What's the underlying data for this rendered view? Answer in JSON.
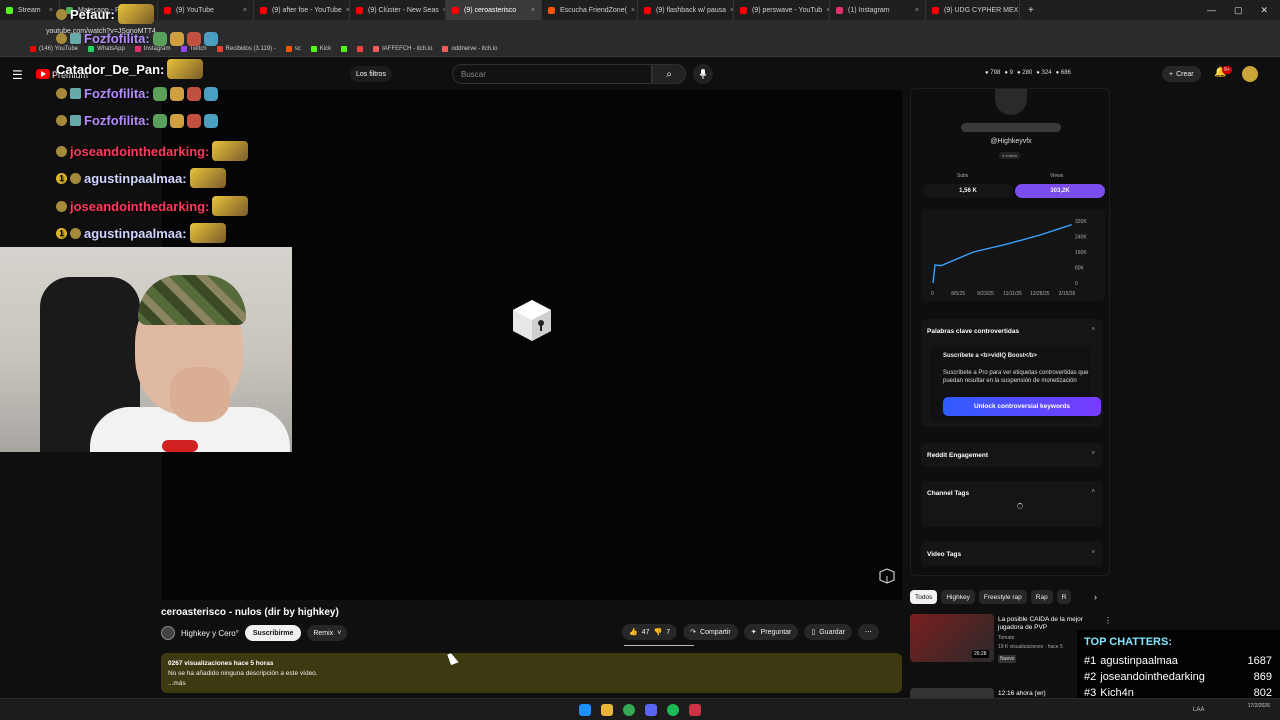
{
  "browser": {
    "tabs": [
      {
        "label": "Stream",
        "color": "#53fc18",
        "width": 60,
        "active": false
      },
      {
        "label": "",
        "color": "#53fc18",
        "width": 0,
        "active": false
      },
      {
        "label": "Matecapp - Ranking y",
        "color": "#4caf50",
        "width": 98,
        "active": false
      },
      {
        "label": "(9) YouTube",
        "color": "#ff0000",
        "width": 96,
        "active": false
      },
      {
        "label": "(9) after foe - YouTube",
        "color": "#ff0000",
        "width": 96,
        "active": false
      },
      {
        "label": "(9) Clúster - New Seas",
        "color": "#ff0000",
        "width": 96,
        "active": false
      },
      {
        "label": "(9) ceroasterisco",
        "color": "#ff0000",
        "width": 96,
        "active": true
      },
      {
        "label": "Escucha FriendZone(",
        "color": "#ff5500",
        "width": 96,
        "active": false
      },
      {
        "label": "(9) flashback w/ pausa",
        "color": "#ff0000",
        "width": 96,
        "active": false
      },
      {
        "label": "(9) perswave - YouTub",
        "color": "#ff0000",
        "width": 96,
        "active": false
      },
      {
        "label": "(1) Instagram",
        "color": "#e1306c",
        "width": 96,
        "active": false
      },
      {
        "label": "(9) UDG CYPHER MEX",
        "color": "#ff0000",
        "width": 94,
        "active": false
      }
    ],
    "tab_close": "×",
    "new_tab": "+",
    "window_controls": [
      "—",
      "▢",
      "✕"
    ],
    "url": "youtube.com/watch?v=JSgnoMTT4",
    "bookmarks": [
      {
        "label": "(146) YouTube",
        "color": "#ff0000"
      },
      {
        "label": "WhatsApp",
        "color": "#25d366"
      },
      {
        "label": "Instagram",
        "color": "#e1306c"
      },
      {
        "label": "Twitch",
        "color": "#9146ff"
      },
      {
        "label": "Recibidos (3.119) -",
        "color": "#ea4335"
      },
      {
        "label": "sc",
        "color": "#ff5500"
      },
      {
        "label": "Kick",
        "color": "#53fc18"
      },
      {
        "label": "",
        "color": "#53fc18"
      },
      {
        "label": "",
        "color": "#ff4444"
      },
      {
        "label": "IAFFEFCH - itch.io",
        "color": "#fa5c5c"
      },
      {
        "label": "oddnerve - itch.io",
        "color": "#fa5c5c"
      }
    ]
  },
  "youtube_header": {
    "menu_icon": "☰",
    "logo_text": "Premium",
    "filters_label": "Los filtros",
    "search_placeholder": "Buscar",
    "search_icon": "⌕",
    "mic_icon": "🎙",
    "stats": [
      "798",
      "9",
      "280",
      "324",
      "686"
    ],
    "create_label": "Crear",
    "notifications": "9+"
  },
  "chat": [
    {
      "user": "Pefaur:",
      "color": "#ffffff",
      "top": 2,
      "badges": [
        "gray"
      ],
      "emotes": 1
    },
    {
      "user": "Fozfofilita:",
      "color": "#b58cff",
      "top": 29,
      "badges": [
        "gray",
        "sub"
      ],
      "emotes": 4
    },
    {
      "user": "Catador_De_Pan:",
      "color": "#ffffff",
      "top": 57,
      "badges": [],
      "emotes": 1
    },
    {
      "user": "Fozfofilita:",
      "color": "#b58cff",
      "top": 84,
      "badges": [
        "gray",
        "sub"
      ],
      "emotes": 4
    },
    {
      "user": "Fozfofilita:",
      "color": "#b58cff",
      "top": 111,
      "badges": [
        "gray",
        "sub"
      ],
      "emotes": 4
    },
    {
      "user": "joseandointhedarking:",
      "color": "#ff3b5c",
      "top": 139,
      "badges": [
        "gray"
      ],
      "emotes": 1
    },
    {
      "user": "agustinpaalmaa:",
      "color": "#cfd6ff",
      "top": 166,
      "badges": [
        "one",
        "gray"
      ],
      "emotes": 1
    },
    {
      "user": "joseandointhedarking:",
      "color": "#ff3b5c",
      "top": 194,
      "badges": [
        "gray"
      ],
      "emotes": 1
    },
    {
      "user": "agustinpaalmaa:",
      "color": "#cfd6ff",
      "top": 221,
      "badges": [
        "one",
        "gray"
      ],
      "emotes": 1
    }
  ],
  "video": {
    "title": "ceroasterisco - nulos (dir by highkey)",
    "channel": "Highkey y Cero°",
    "subscribe_label": "Suscribirme",
    "remix_label": "Remix",
    "likes": "47",
    "dislikes": "7",
    "share_label": "Compartir",
    "ask_label": "Preguntar",
    "save_label": "Guardar",
    "more_icon": "⋯",
    "views_line": "0267 visualizaciones  hace 5 horas",
    "description": "No se ha añadido ninguna descripción a este vídeo.",
    "more_label": "...más"
  },
  "side_panel": {
    "handle": "@Highkeyvfx",
    "videos_count": "4 vídeos",
    "subs_label": "Subs",
    "views_label": "Views",
    "subs_value": "1,56 K",
    "views_value": "303,2K",
    "chart_yticks": [
      "320K",
      "240K",
      "160K",
      "80K",
      "0"
    ],
    "chart_xticks": [
      "0",
      "8/5/25",
      "9/23/25",
      "11/11/25",
      "12/28/25",
      "2/15/26"
    ],
    "controversial_title": "Palabras clave controvertidas",
    "boost_title": "Suscríbete a <b>vidIQ Boost</b>",
    "boost_text": "Suscríbete a Pro para ver etiquetas controvertidas que puedan resultar en la suspensión de monetización",
    "unlock_label": "Unlock controversial keywords",
    "reddit_title": "Reddit Engagement",
    "channel_tags_title": "Channel Tags",
    "video_tags_title": "Video Tags",
    "chevron_up": "˄",
    "chevron_down": "˅"
  },
  "chart_data": {
    "type": "line",
    "x": [
      "8/5/25",
      "9/23/25",
      "11/11/25",
      "12/28/25",
      "2/15/26"
    ],
    "series": [
      {
        "values": [
          90000,
          160000,
          200000,
          245000,
          300000
        ]
      }
    ],
    "ylim": [
      0,
      320000
    ],
    "y_ticks": [
      "320K",
      "240K",
      "160K",
      "80K",
      "0"
    ],
    "color": "#3aa0ff"
  },
  "chips": [
    "Todos",
    "Highkey",
    "Freestyle rap",
    "Rap",
    "R"
  ],
  "chip_next": "›",
  "recommendation": {
    "title": "La posible CAIDA de la mejor jugadora de PVP",
    "channel": "Tomate",
    "meta": "19 K visualizaciones · hace 5",
    "badge": "Nuevo",
    "duration": "26:28",
    "dots": "⋮"
  },
  "recommendation2": {
    "title": "12:16 ahora (wr)"
  },
  "top_chatters": {
    "title": "TOP CHATTERS:",
    "rows": [
      {
        "rank": "#1",
        "name": "agustinpaalmaa",
        "count": "1687"
      },
      {
        "rank": "#2",
        "name": "joseandointhedarking",
        "count": "869"
      },
      {
        "rank": "#3",
        "name": "Kich4n",
        "count": "802"
      }
    ]
  },
  "taskbar": {
    "apps": [
      {
        "name": "windows",
        "color": "#1e90ff"
      },
      {
        "name": "files",
        "color": "#e8b33a"
      },
      {
        "name": "chrome",
        "color": "#34a853"
      },
      {
        "name": "discord",
        "color": "#5865f2"
      },
      {
        "name": "spotify",
        "color": "#1db954"
      },
      {
        "name": "game",
        "color": "#cc3344"
      }
    ],
    "lang": "LAA",
    "date": "17/2/2026"
  }
}
